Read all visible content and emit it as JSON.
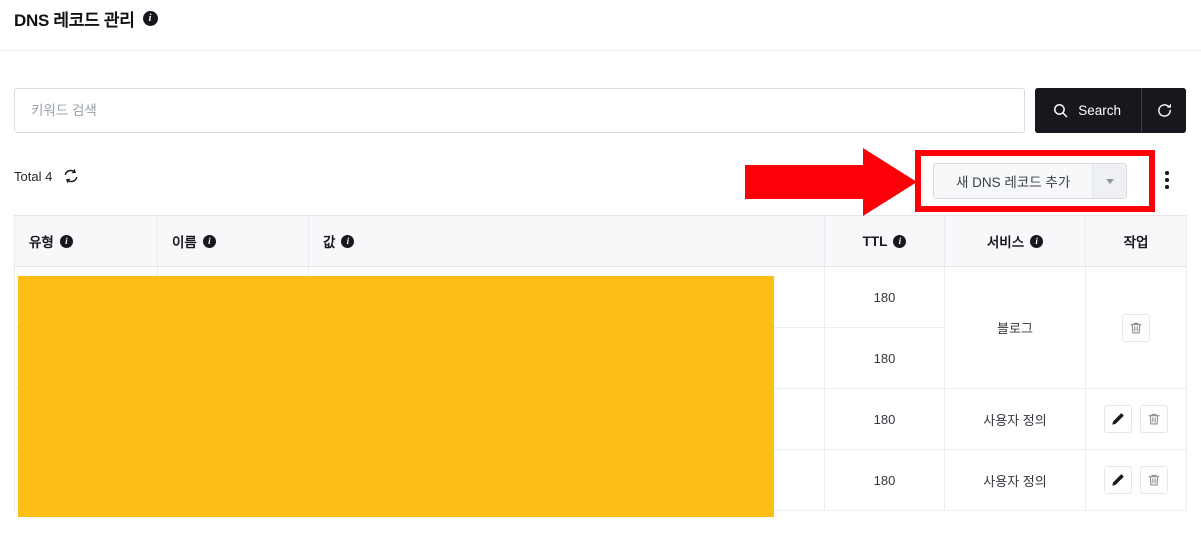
{
  "header": {
    "title": "DNS 레코드 관리",
    "info_icon": "info-icon",
    "info_glyph": "i"
  },
  "search": {
    "placeholder": "키워드 검색",
    "value": "",
    "search_label": "Search",
    "search_icon": "search-icon",
    "reset_icon": "reset-icon"
  },
  "toolbar": {
    "total_label": "Total 4",
    "refresh_icon": "refresh-icon",
    "add_label": "새 DNS 레코드 추가",
    "caret_icon": "chevron-down-icon",
    "kebab_icon": "more-vertical-icon"
  },
  "table": {
    "columns": [
      {
        "label": "유형",
        "has_info": true
      },
      {
        "label": "이름",
        "has_info": true
      },
      {
        "label": "값",
        "has_info": true
      },
      {
        "label": "TTL",
        "has_info": true
      },
      {
        "label": "서비스",
        "has_info": true
      },
      {
        "label": "작업",
        "has_info": false
      }
    ],
    "rows": [
      {
        "type": "",
        "name": "",
        "value": "",
        "ttl": "180",
        "service": "블로그",
        "actions": [
          "delete"
        ]
      },
      {
        "type": "",
        "name": "",
        "value": "",
        "ttl": "180",
        "service": "",
        "actions": []
      },
      {
        "type": "",
        "name": "",
        "value": "",
        "ttl": "180",
        "service": "사용자 정의",
        "actions": [
          "edit",
          "delete"
        ]
      },
      {
        "type": "",
        "name": "",
        "value": "",
        "ttl": "180",
        "service": "사용자 정의",
        "actions": [
          "edit",
          "delete"
        ]
      }
    ]
  },
  "annotations": {
    "highlight_rect_color": "#fb0007",
    "arrow_color": "#fb0007",
    "redaction_color": "#fdbe15"
  },
  "colors": {
    "button_dark": "#16181d",
    "border": "#eaecef",
    "header_bg": "#f7f8fa"
  }
}
